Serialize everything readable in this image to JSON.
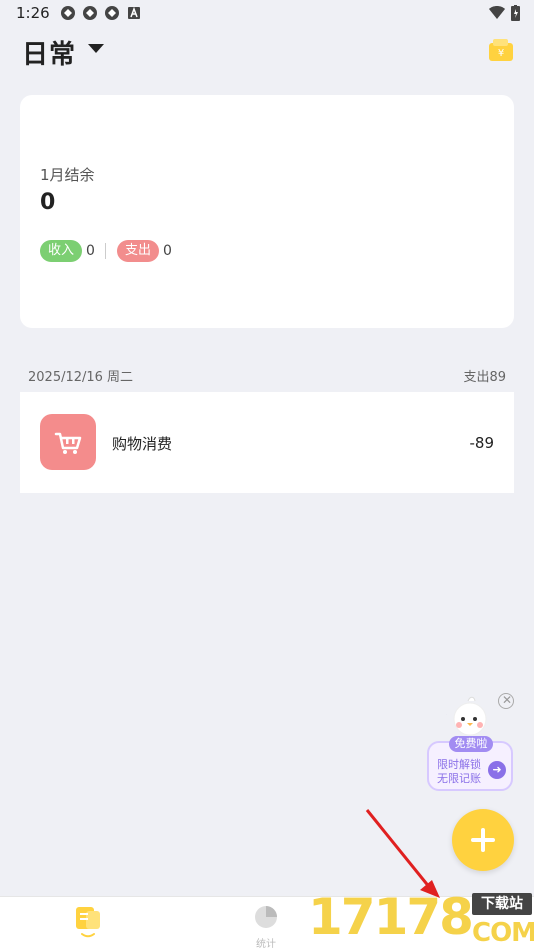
{
  "status_bar": {
    "time": "1:26"
  },
  "header": {
    "ledger_name": "日常"
  },
  "summary": {
    "balance_label": "1月结余",
    "balance_value": "0",
    "income_label": "收入",
    "income_value": "0",
    "expense_label": "支出",
    "expense_value": "0"
  },
  "records": {
    "date_label": "2025/12/16 周二",
    "day_total": "支出89",
    "items": [
      {
        "category": "购物消费",
        "amount": "-89",
        "icon": "shopping-cart-icon"
      }
    ]
  },
  "promo": {
    "badge": "免费啦",
    "line1": "限时解锁",
    "line2": "无限记账"
  },
  "nav": {
    "stats_label": "统计"
  },
  "watermark": {
    "number": "17178",
    "top": "下载站",
    "suffix": "COM"
  },
  "colors": {
    "background": "#eff0f5",
    "accent": "#ffd23f",
    "income": "#7ccf72",
    "expense": "#f28d8d"
  }
}
